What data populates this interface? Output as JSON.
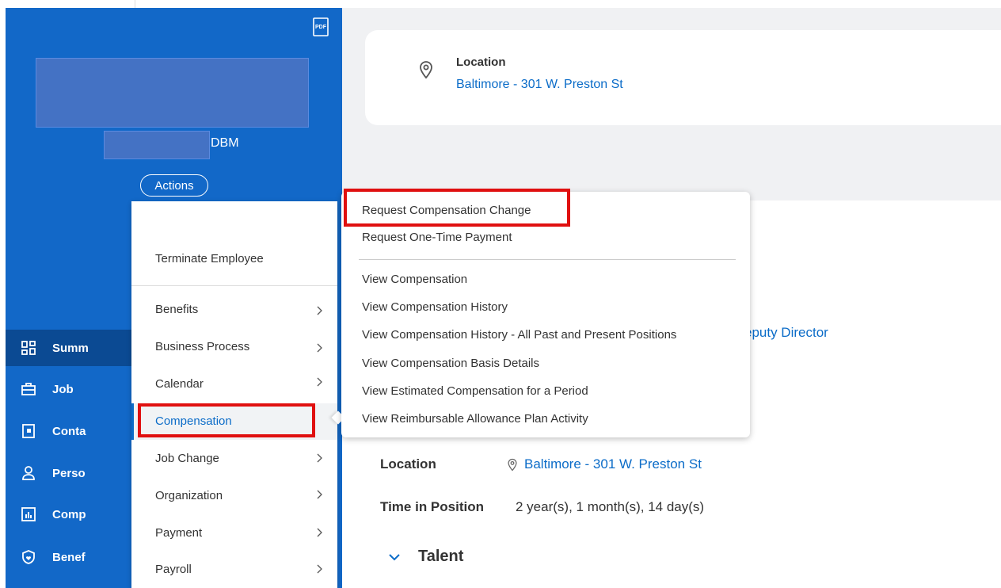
{
  "header": {
    "pdf_icon": "pdf-icon"
  },
  "profile": {
    "name_suffix": "DBM",
    "actions_label": "Actions"
  },
  "nav": {
    "items": [
      {
        "icon": "grid-icon",
        "label": "Summ"
      },
      {
        "icon": "briefcase-icon",
        "label": "Job"
      },
      {
        "icon": "contact-card-icon",
        "label": "Conta"
      },
      {
        "icon": "person-icon",
        "label": "Perso"
      },
      {
        "icon": "chart-icon",
        "label": "Comp"
      },
      {
        "icon": "shield-icon",
        "label": "Benef"
      }
    ]
  },
  "location_card": {
    "title": "Location",
    "link": "Baltimore - 301 W. Preston St"
  },
  "job_details": {
    "deputy_link": "eputy Director",
    "location_label": "Location",
    "location_value": "Baltimore - 301 W. Preston St",
    "time_label": "Time in Position",
    "time_value": "2 year(s), 1 month(s), 14 day(s)",
    "talent_heading": "Talent"
  },
  "actions_menu": {
    "items": [
      {
        "label": "Terminate Employee"
      },
      {
        "label": "Benefits"
      },
      {
        "label": "Business Process"
      },
      {
        "label": "Calendar"
      },
      {
        "label": "Compensation"
      },
      {
        "label": "Job Change"
      },
      {
        "label": "Organization"
      },
      {
        "label": "Payment"
      },
      {
        "label": "Payroll"
      }
    ]
  },
  "compensation_submenu": {
    "items": [
      {
        "label": "Request Compensation Change"
      },
      {
        "label": "Request One-Time Payment"
      },
      {
        "label": "View Compensation"
      },
      {
        "label": "View Compensation History"
      },
      {
        "label": "View Compensation History - All Past and Present Positions"
      },
      {
        "label": "View Compensation Basis Details"
      },
      {
        "label": "View Estimated Compensation for a Period"
      },
      {
        "label": "View Reimbursable Allowance Plan Activity"
      }
    ]
  },
  "colors": {
    "panel_blue": "#1268c8",
    "active_blue": "#0b4a93",
    "link_blue": "#0b6cc8",
    "highlight_red": "#e01010",
    "redaction_blue": "#4472c4"
  }
}
